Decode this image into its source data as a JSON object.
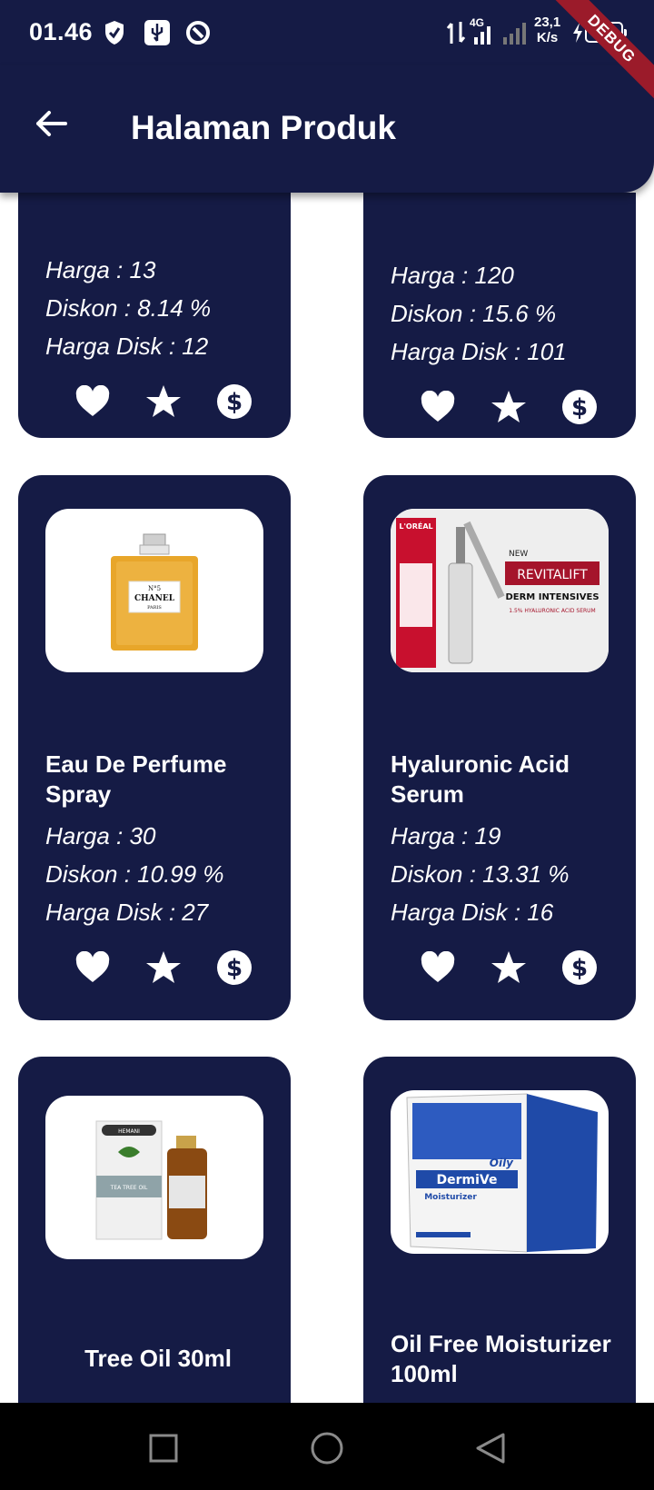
{
  "status_bar": {
    "time": "01.46",
    "net_type": "4G",
    "net_speed": "23,1\nK/s",
    "net_speed_value": "23,1",
    "net_speed_unit": "K/s",
    "battery": "18"
  },
  "debug_banner": "DEBUG",
  "app_bar": {
    "title": "Halaman Produk"
  },
  "products": [
    {
      "name": "",
      "harga": "Harga : 13",
      "diskon": "Diskon : 8.14 %",
      "harga_disk": "Harga Disk : 12"
    },
    {
      "name": "",
      "harga": "Harga : 120",
      "diskon": "Diskon : 15.6 %",
      "harga_disk": "Harga Disk : 101"
    },
    {
      "name": "Eau De Perfume Spray",
      "harga": "Harga : 30",
      "diskon": "Diskon : 10.99 %",
      "harga_disk": "Harga Disk : 27",
      "image": {
        "brand": "CHANEL",
        "line1": "N°5",
        "line2": "PARIS"
      }
    },
    {
      "name": "Hyaluronic Acid Serum",
      "harga": "Harga : 19",
      "diskon": "Diskon : 13.31 %",
      "harga_disk": "Harga Disk : 16",
      "image": {
        "brand": "L'ORÉAL",
        "new": "NEW",
        "line1": "REVITALIFT",
        "line2": "DERM INTENSIVES",
        "line3": "1.5% HYALURONIC ACID SERUM"
      }
    },
    {
      "name": "Tree Oil 30ml",
      "image": {
        "brand": "HEMANI",
        "line1": "TEA TREE OIL"
      }
    },
    {
      "name": "Oil Free Moisturizer 100ml",
      "image": {
        "line1": "Oily",
        "brand": "DermiVe",
        "line2": "Moisturizer"
      }
    }
  ],
  "icons": {
    "like": "heart-icon",
    "favorite": "star-icon",
    "buy": "dollar-icon"
  },
  "colors": {
    "primary": "#151b45",
    "text": "#ffffff",
    "debug": "#9b1b2a"
  }
}
